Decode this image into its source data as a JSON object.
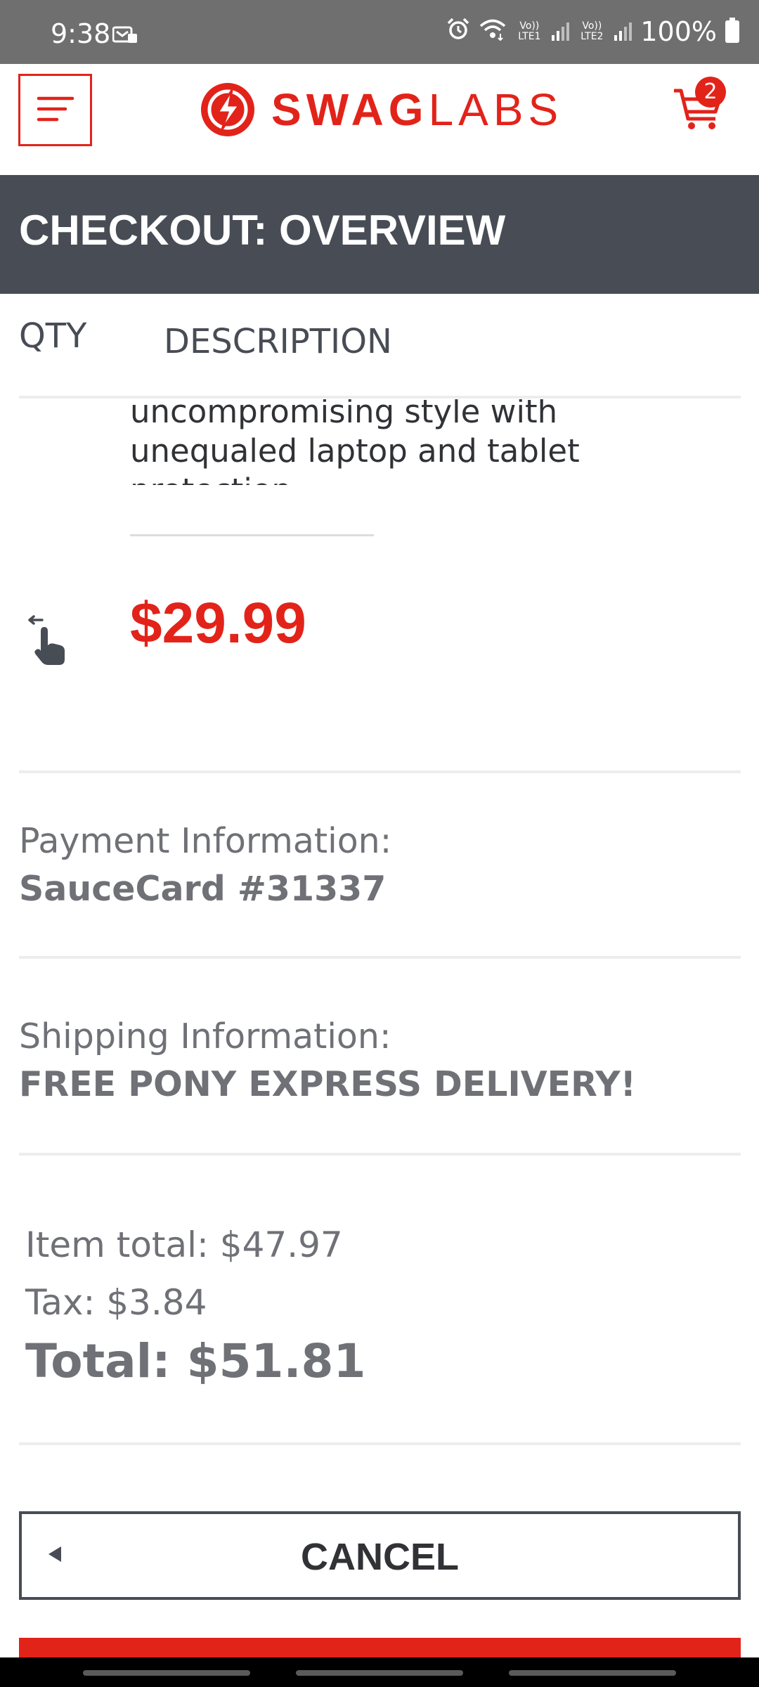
{
  "status_bar": {
    "time": "9:38",
    "sim1_label": "Vo)) LTE1",
    "sim2_label": "Vo)) LTE2",
    "battery": "100%"
  },
  "header": {
    "logo_bold": "SWAG",
    "logo_light": "LABS",
    "cart_count": "2"
  },
  "page": {
    "title": "CHECKOUT: OVERVIEW"
  },
  "columns": {
    "qty": "QTY",
    "description": "DESCRIPTION"
  },
  "item": {
    "description": "uncompromising style with unequaled laptop and tablet protection.",
    "price": "$29.99"
  },
  "payment": {
    "label": "Payment Information:",
    "value": "SauceCard #31337"
  },
  "shipping": {
    "label": "Shipping Information:",
    "value": "FREE PONY EXPRESS DELIVERY!"
  },
  "summary": {
    "item_total": "Item total: $47.97",
    "tax": "Tax: $3.84",
    "total": "Total: $51.81"
  },
  "actions": {
    "cancel": "CANCEL"
  },
  "colors": {
    "brand_red": "#e2231a",
    "header_dark": "#474c55",
    "status_gray": "#6f6f6f"
  },
  "icons": [
    "notification-icon",
    "alarm-icon",
    "wifi-icon",
    "signal-icon",
    "battery-icon",
    "menu-icon",
    "logo-bolt-icon",
    "cart-icon",
    "swipe-hand-icon",
    "back-arrow-icon"
  ]
}
